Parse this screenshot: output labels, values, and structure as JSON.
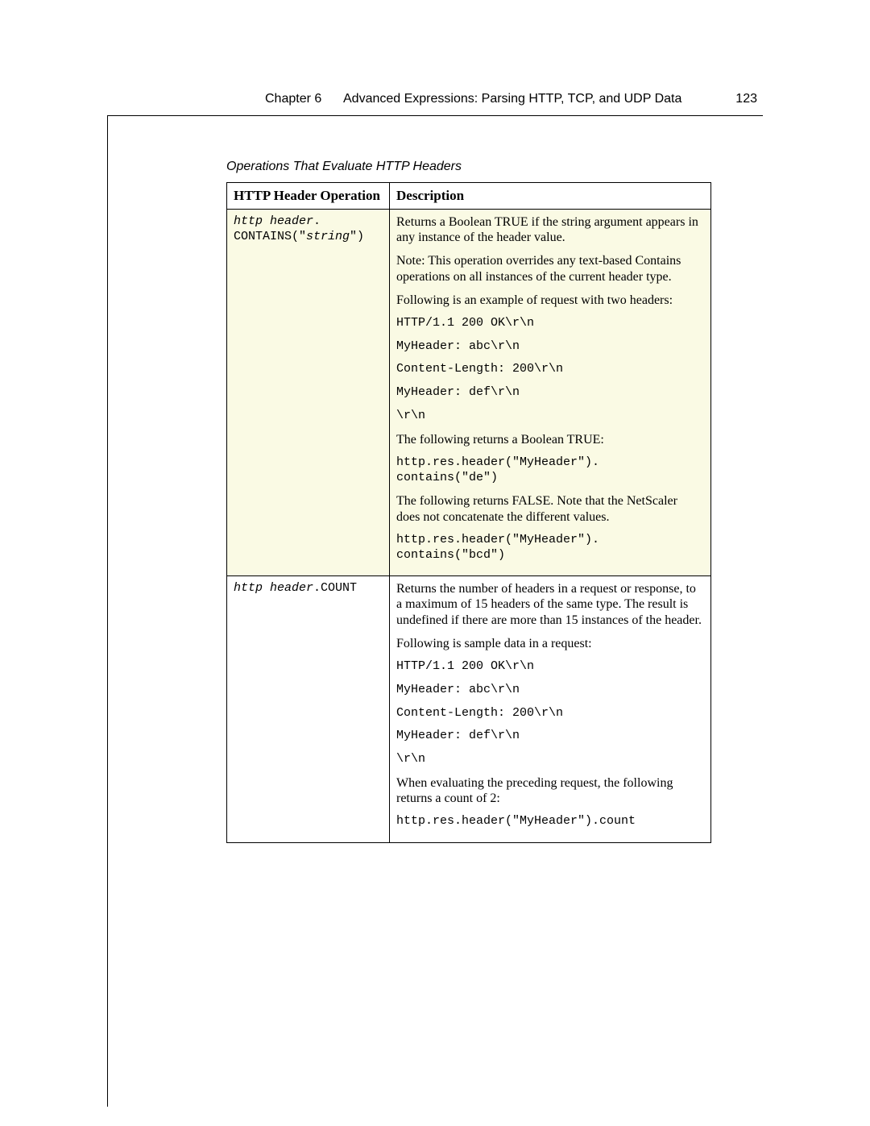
{
  "header": {
    "chapter": "Chapter 6",
    "title": "Advanced Expressions: Parsing HTTP, TCP, and UDP Data",
    "pagenum": "123"
  },
  "caption": "Operations That Evaluate HTTP Headers",
  "columns": {
    "c1": "HTTP Header Operation",
    "c2": "Description"
  },
  "row1": {
    "op_prefix": "http header",
    "op_line1_suffix": ".",
    "op_line2_a": "CONTAINS(\"",
    "op_arg": "string",
    "op_line2_b": "\")",
    "p1": "Returns a Boolean TRUE if the string argument appears in any instance of the header value.",
    "p2": "Note: This operation overrides any text-based Contains operations on all instances of the current header type.",
    "p3": "Following is an example of request with two headers:",
    "c1": "HTTP/1.1 200 OK\\r\\n",
    "c2": "MyHeader: abc\\r\\n",
    "c3": "Content-Length: 200\\r\\n",
    "c4": "MyHeader: def\\r\\n",
    "c5": "\\r\\n",
    "p4": "The following returns a Boolean TRUE:",
    "c6": "http.res.header(\"MyHeader\").\ncontains(\"de\")",
    "p5": "The following returns FALSE. Note that the NetScaler does not concatenate the different values.",
    "c7": "http.res.header(\"MyHeader\").\ncontains(\"bcd\")"
  },
  "row2": {
    "op_prefix": "http header",
    "op_suffix": ".COUNT",
    "p1": "Returns the number of headers in a request or response, to a maximum of 15 headers of the same type. The result is undefined if there are more than 15 instances of the header.",
    "p2": "Following is sample data in a request:",
    "c1": "HTTP/1.1 200 OK\\r\\n",
    "c2": "MyHeader: abc\\r\\n",
    "c3": "Content-Length: 200\\r\\n",
    "c4": "MyHeader: def\\r\\n",
    "c5": "\\r\\n",
    "p3": "When evaluating the preceding request, the following returns a count of 2:",
    "c6": "http.res.header(\"MyHeader\").count"
  }
}
